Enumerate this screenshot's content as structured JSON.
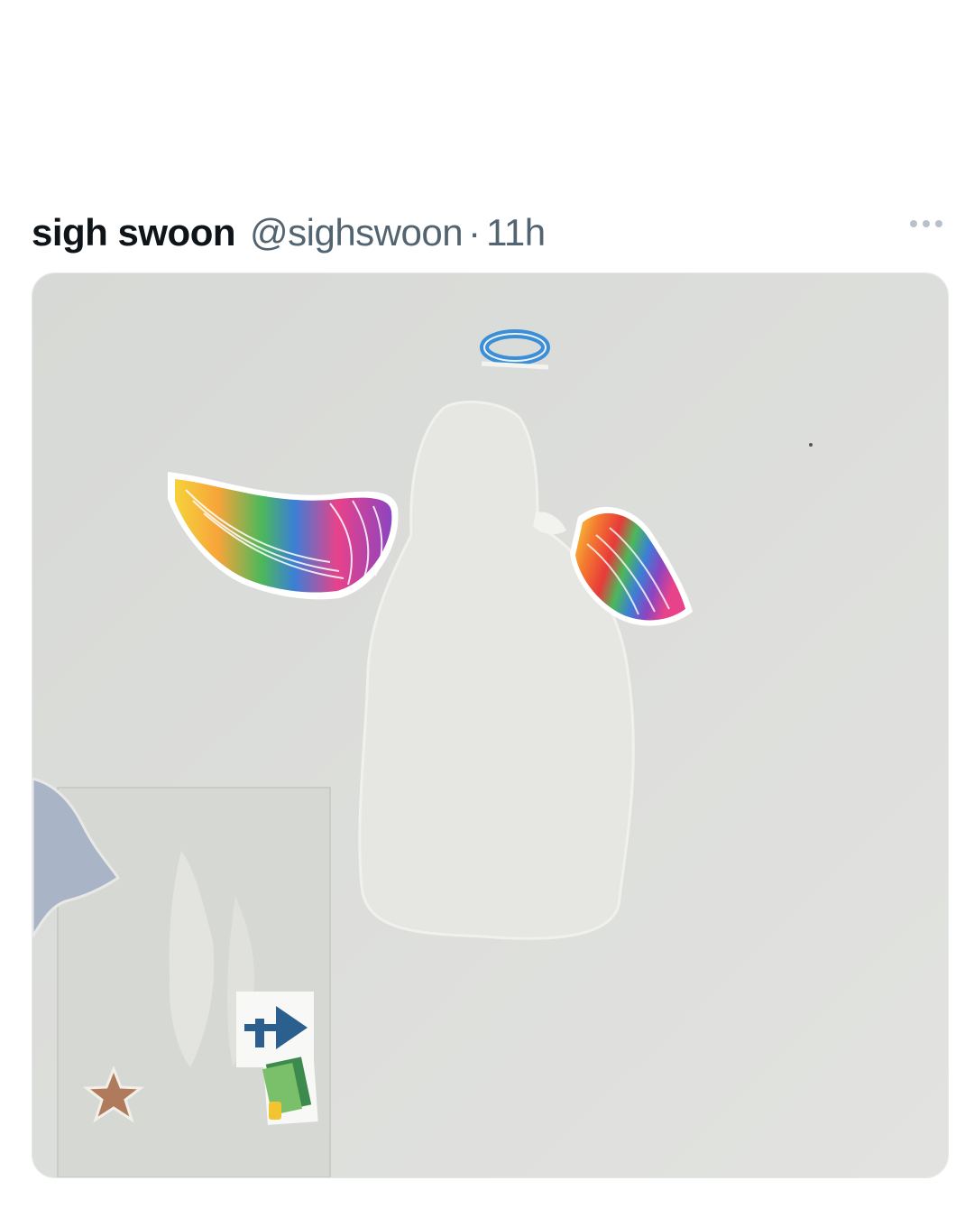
{
  "tweet": {
    "display_name": "sigh swoon",
    "handle": "@sighswoon",
    "separator": "·",
    "timestamp": "11h",
    "more_icon": "more-horizontal-icon"
  },
  "media": {
    "kind": "photo",
    "colors": {
      "wall": "#dcdedb",
      "halo": "#3c8fd6"
    }
  }
}
